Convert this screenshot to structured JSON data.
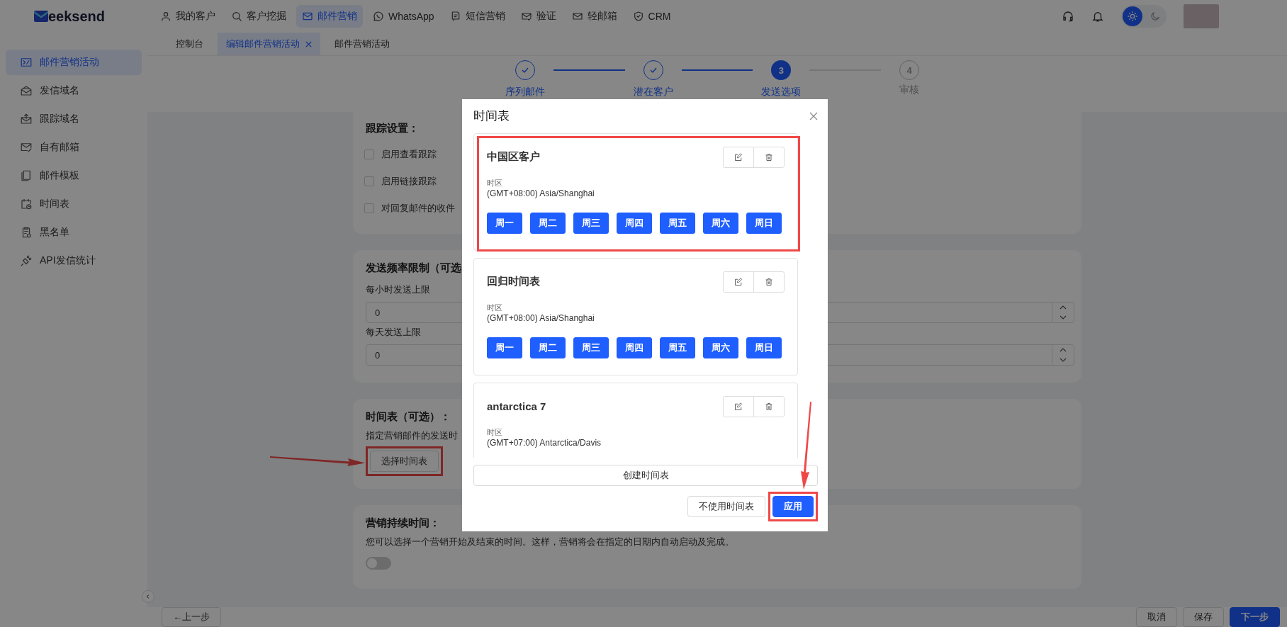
{
  "nav": {
    "logo_text": "eeksend",
    "items": [
      {
        "label": "我的客户",
        "selected": false
      },
      {
        "label": "客户挖掘",
        "selected": false
      },
      {
        "label": "邮件营销",
        "selected": true
      },
      {
        "label": "WhatsApp",
        "selected": false
      },
      {
        "label": "短信营销",
        "selected": false
      },
      {
        "label": "验证",
        "selected": false
      },
      {
        "label": "轻邮箱",
        "selected": false
      },
      {
        "label": "CRM",
        "selected": false
      }
    ],
    "theme": [
      {
        "kind": "light",
        "selected": true
      },
      {
        "kind": "dark",
        "selected": false
      }
    ]
  },
  "tabs": [
    {
      "label": "控制台",
      "selected": false,
      "closable": false
    },
    {
      "label": "编辑邮件营销活动",
      "selected": true,
      "closable": true
    },
    {
      "label": "邮件营销活动",
      "selected": false,
      "closable": false
    }
  ],
  "sidebar": {
    "items": [
      {
        "label": "邮件营销活动",
        "selected": true
      },
      {
        "label": "发信域名",
        "selected": false
      },
      {
        "label": "跟踪域名",
        "selected": false
      },
      {
        "label": "自有邮箱",
        "selected": false
      },
      {
        "label": "邮件模板",
        "selected": false
      },
      {
        "label": "时间表",
        "selected": false
      },
      {
        "label": "黑名单",
        "selected": false
      },
      {
        "label": "API发信统计",
        "selected": false
      }
    ]
  },
  "steps": [
    {
      "label": "序列邮件",
      "completed": true,
      "active": false
    },
    {
      "label": "潜在客户",
      "completed": true,
      "active": false
    },
    {
      "label": "发送选项",
      "completed": false,
      "active": true,
      "number": "3"
    },
    {
      "label": "审核",
      "completed": false,
      "active": false,
      "number": "4"
    }
  ],
  "tracking": {
    "title": "跟踪设置：",
    "options": [
      {
        "label": "启用查看跟踪",
        "checked": false
      },
      {
        "label": "启用链接跟踪",
        "checked": false
      },
      {
        "label": "对回复邮件的收件",
        "checked": false
      }
    ]
  },
  "rate_limit": {
    "title": "发送频率限制（可选",
    "fields": [
      {
        "label": "每小时发送上限",
        "value": "0"
      },
      {
        "label": "每天发送上限",
        "value": "0"
      }
    ]
  },
  "schedule_section": {
    "title": "时间表（可选）：",
    "description": "指定营销邮件的发送时",
    "button": {
      "label": "选择时间表",
      "highlighted": true,
      "arrow": true
    }
  },
  "duration": {
    "title": "营销持续时间：",
    "description": "您可以选择一个营销开始及结束的时间。这样，营销将会在指定的日期内自动启动及完成。",
    "enabled": false
  },
  "footer": {
    "back": "←上一步",
    "cancel": "取消",
    "save": "保存",
    "next": "下一步"
  },
  "modal": {
    "title": "时间表",
    "schedules": [
      {
        "name": "中国区客户",
        "highlighted": true,
        "timezone_label": "时区",
        "timezone": "(GMT+08:00) Asia/Shanghai",
        "days": [
          {
            "label": "周一",
            "selected": true
          },
          {
            "label": "周二",
            "selected": true
          },
          {
            "label": "周三",
            "selected": true
          },
          {
            "label": "周四",
            "selected": true
          },
          {
            "label": "周五",
            "selected": true
          },
          {
            "label": "周六",
            "selected": true
          },
          {
            "label": "周日",
            "selected": true
          }
        ]
      },
      {
        "name": "回归时间表",
        "highlighted": false,
        "timezone_label": "时区",
        "timezone": "(GMT+08:00) Asia/Shanghai",
        "days": [
          {
            "label": "周一",
            "selected": true
          },
          {
            "label": "周二",
            "selected": true
          },
          {
            "label": "周三",
            "selected": true
          },
          {
            "label": "周四",
            "selected": true
          },
          {
            "label": "周五",
            "selected": true
          },
          {
            "label": "周六",
            "selected": true
          },
          {
            "label": "周日",
            "selected": true
          }
        ]
      },
      {
        "name": "antarctica 7",
        "highlighted": false,
        "timezone_label": "时区",
        "timezone": "(GMT+07:00) Antarctica/Davis"
      }
    ],
    "create_button": "创建时间表",
    "buttons": [
      {
        "label": "不使用时间表",
        "kind": "default",
        "highlighted": false
      },
      {
        "label": "应用",
        "kind": "primary",
        "highlighted": true,
        "arrow": true
      }
    ]
  }
}
